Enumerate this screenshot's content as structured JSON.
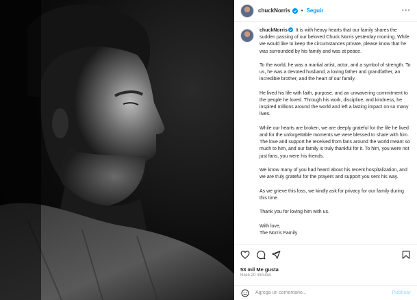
{
  "post": {
    "username": "chuckNorris",
    "follow_label": "Seguir",
    "separator": "•",
    "more_label": "···"
  },
  "caption": {
    "username": "chuckNorris",
    "paragraphs": [
      "It is with heavy hearts that our family shares the sudden passing of our beloved Chuck Norris yesterday morning. While we would like to keep the circumstances private, please know that he was surrounded by his family and was at peace.",
      "To the world, he was a martial artist, actor, and a symbol of strength. To us, he was a devoted husband, a loving father and grandfather, an incredible brother, and the heart of our family.",
      "He lived his life with faith, purpose, and an unwavering commitment to the people he loved. Through his work, discipline, and kindness, he inspired millions around the world and left a lasting impact on so many lives.",
      "While our hearts are broken, we are deeply grateful for the life he lived and for the unforgettable moments we were blessed to share with him. The love and support he received from fans around the world meant so much to him, and our family is truly thankful for it. To him, you were not just fans, you were his friends.",
      "We know many of you had heard about his recent hospitalization, and we are truly grateful for the prayers and support you sent his way.",
      "As we grieve this loss, we kindly ask for privacy for our family during this time.",
      "Thank you for loving him with us."
    ],
    "signoff_1": "With love,",
    "signoff_2": "The Norris Family"
  },
  "actions": {
    "likes": "53 mil Me gusta",
    "time": "Hace 20 minutos"
  },
  "comment_box": {
    "placeholder": "Agrega un comentario...",
    "publish_label": "Publicar"
  },
  "colors": {
    "accent": "#0095f6",
    "verified": "#0095f6",
    "muted": "#8e8e8e"
  },
  "icons": [
    "heart-icon",
    "comment-icon",
    "share-icon",
    "bookmark-icon",
    "emoji-icon",
    "verified-icon",
    "more-icon"
  ]
}
